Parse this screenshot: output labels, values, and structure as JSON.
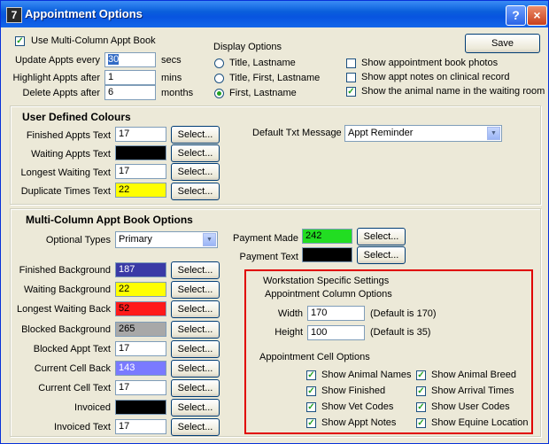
{
  "window": {
    "title": "Appointment Options",
    "app_icon": "7",
    "help": "?",
    "close": "×"
  },
  "top": {
    "use_multi_column": {
      "label": "Use Multi-Column Appt Book",
      "checked": true
    },
    "update": {
      "label": "Update Appts every",
      "value": "30",
      "unit": "secs"
    },
    "highlight": {
      "label": "Highlight Appts after",
      "value": "1",
      "unit": "mins"
    },
    "delete": {
      "label": "Delete Appts after",
      "value": "6",
      "unit": "months"
    },
    "display_options": {
      "title": "Display Options",
      "options": [
        {
          "label": "Title, Lastname",
          "selected": false
        },
        {
          "label": "Title, First, Lastname",
          "selected": false
        },
        {
          "label": "First, Lastname",
          "selected": true
        }
      ]
    },
    "save": "Save",
    "checks": [
      {
        "label": "Show appointment book photos",
        "checked": false
      },
      {
        "label": "Show appt notes on clinical record",
        "checked": false
      },
      {
        "label": "Show the animal name in the waiting room",
        "checked": true
      }
    ]
  },
  "udc": {
    "title": "User Defined Colours",
    "rows": [
      {
        "label": "Finished Appts Text",
        "value": "17",
        "color": "#ffffff",
        "text_color": "#000000",
        "button": "Select..."
      },
      {
        "label": "Waiting Appts Text",
        "value": "",
        "color": "#000000",
        "text_color": "#ffffff",
        "button": "Select..."
      },
      {
        "label": "Longest Waiting Text",
        "value": "17",
        "color": "#ffffff",
        "text_color": "#000000",
        "button": "Select..."
      },
      {
        "label": "Duplicate Times Text",
        "value": "22",
        "color": "#ffff00",
        "text_color": "#000000",
        "button": "Select..."
      }
    ],
    "default_txt_label": "Default Txt Message",
    "default_txt_value": "Appt Reminder"
  },
  "mc": {
    "title": "Multi-Column Appt Book Options",
    "optional_types_label": "Optional Types",
    "optional_types_value": "Primary",
    "rows": [
      {
        "label": "Finished Background",
        "value": "187",
        "color": "#3a3aa6",
        "text_color": "#ffffff",
        "button": "Select..."
      },
      {
        "label": "Waiting Background",
        "value": "22",
        "color": "#ffff00",
        "text_color": "#000000",
        "button": "Select..."
      },
      {
        "label": "Longest Waiting Back",
        "value": "52",
        "color": "#ff1a1a",
        "text_color": "#000000",
        "button": "Select..."
      },
      {
        "label": "Blocked Background",
        "value": "265",
        "color": "#a8a8a8",
        "text_color": "#000000",
        "button": "Select..."
      },
      {
        "label": "Blocked Appt Text",
        "value": "17",
        "color": "#ffffff",
        "text_color": "#000000",
        "button": "Select..."
      },
      {
        "label": "Current Cell Back",
        "value": "143",
        "color": "#7a7aff",
        "text_color": "#ffffff",
        "button": "Select..."
      },
      {
        "label": "Current Cell Text",
        "value": "17",
        "color": "#ffffff",
        "text_color": "#000000",
        "button": "Select..."
      },
      {
        "label": "Invoiced",
        "value": "",
        "color": "#000000",
        "text_color": "#ffffff",
        "button": "Select..."
      },
      {
        "label": "Invoiced Text",
        "value": "17",
        "color": "#ffffff",
        "text_color": "#000000",
        "button": "Select..."
      }
    ],
    "payment_made": {
      "label": "Payment Made",
      "value": "242",
      "color": "#22dd22",
      "text_color": "#000000",
      "button": "Select..."
    },
    "payment_text": {
      "label": "Payment Text",
      "value": "",
      "color": "#000000",
      "text_color": "#ffffff",
      "button": "Select..."
    }
  },
  "ws": {
    "title": "Workstation Specific Settings",
    "col_title": "Appointment Column Options",
    "width": {
      "label": "Width",
      "value": "170",
      "note": "(Default is 170)"
    },
    "height": {
      "label": "Height",
      "value": "100",
      "note": "(Default is 35)"
    },
    "cell_title": "Appointment Cell Options",
    "cells": [
      {
        "label": "Show Animal Names",
        "checked": true
      },
      {
        "label": "Show Animal Breed",
        "checked": true
      },
      {
        "label": "Show Finished",
        "checked": true
      },
      {
        "label": "Show Arrival Times",
        "checked": true
      },
      {
        "label": "Show Vet Codes",
        "checked": true
      },
      {
        "label": "Show User Codes",
        "checked": true
      },
      {
        "label": "Show Appt Notes",
        "checked": true
      },
      {
        "label": "Show Equine Location",
        "checked": true
      }
    ]
  }
}
